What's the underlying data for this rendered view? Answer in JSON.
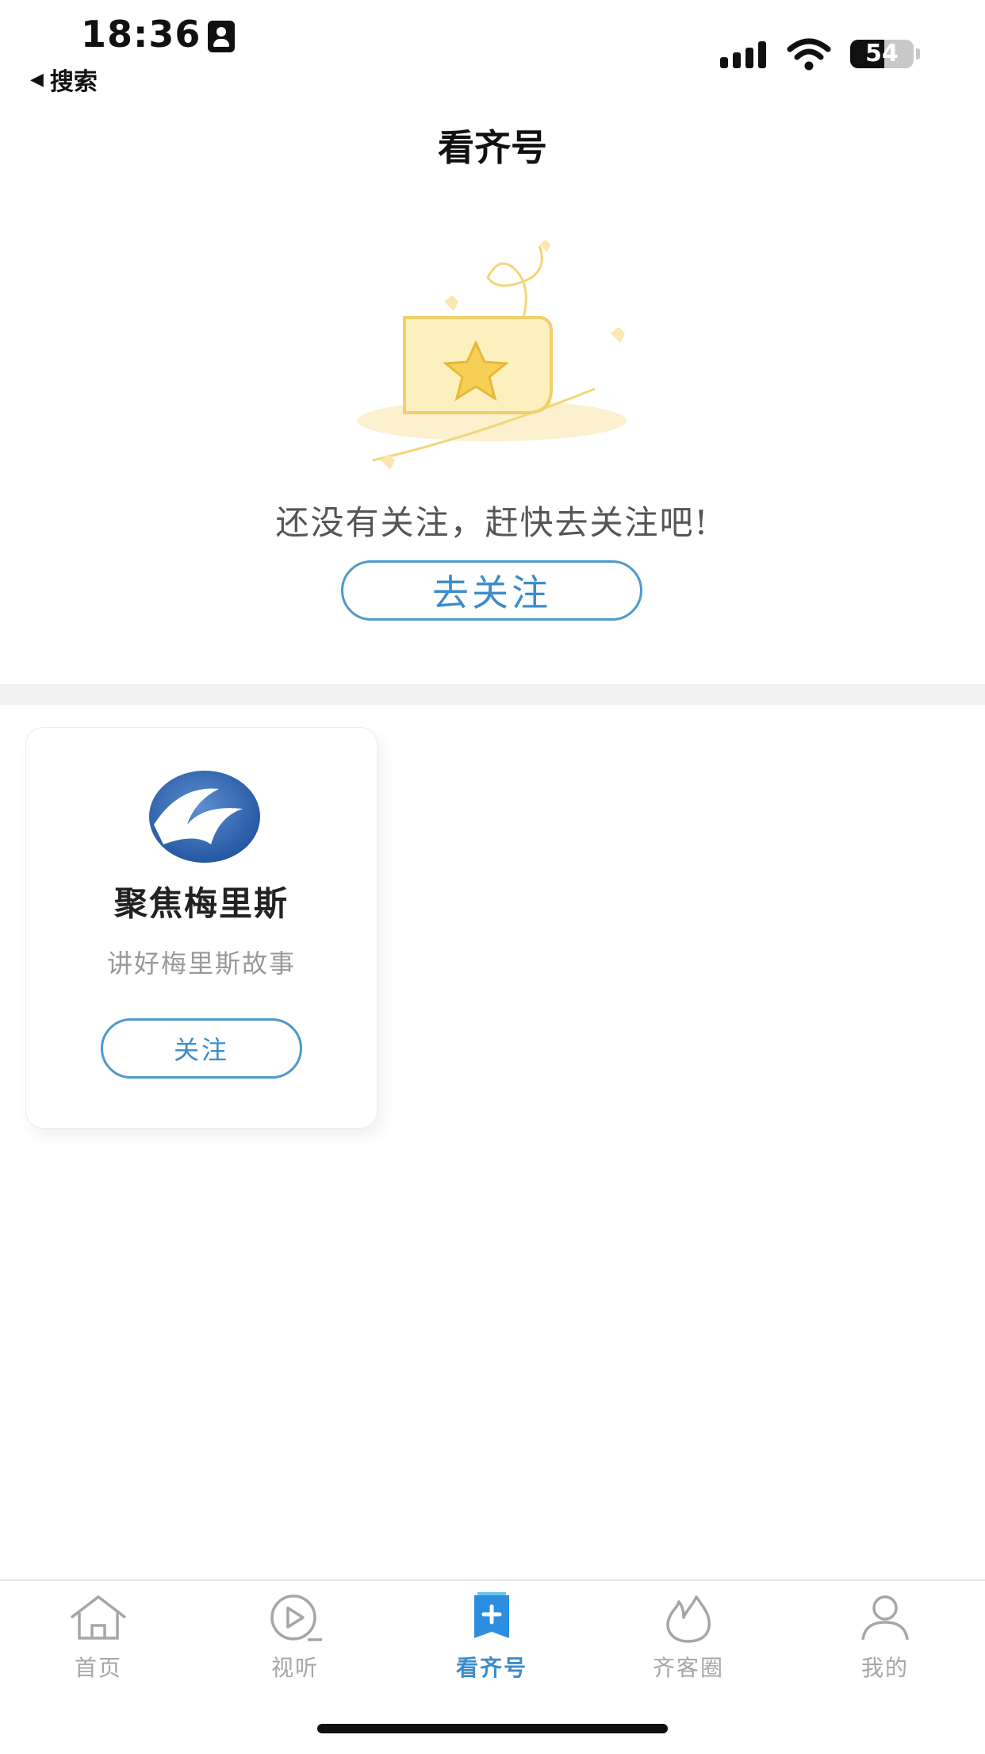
{
  "status_bar": {
    "time": "18:36",
    "back_label": "搜索",
    "battery_level": "54",
    "battery_fraction": 0.54
  },
  "header": {
    "title": "看齐号"
  },
  "empty_state": {
    "message": "还没有关注，赶快去关注吧!",
    "cta_label": "去关注",
    "illustration": "star-folder-illustration"
  },
  "recommendation_card": {
    "name": "聚焦梅里斯",
    "description": "讲好梅里斯故事",
    "follow_label": "关注",
    "avatar": "blue-bird-globe-logo"
  },
  "tabbar": {
    "items": [
      {
        "label": "首页",
        "icon": "home-icon"
      },
      {
        "label": "视听",
        "icon": "play-icon"
      },
      {
        "label": "看齐号",
        "icon": "bookmark-plus-icon"
      },
      {
        "label": "齐客圈",
        "icon": "flame-icon"
      },
      {
        "label": "我的",
        "icon": "user-icon"
      }
    ],
    "active_index": 2
  },
  "colors": {
    "accent": "#3c8ccc",
    "tab_inactive": "#a6a6a6",
    "illustration_gold": "#f2d77a"
  }
}
